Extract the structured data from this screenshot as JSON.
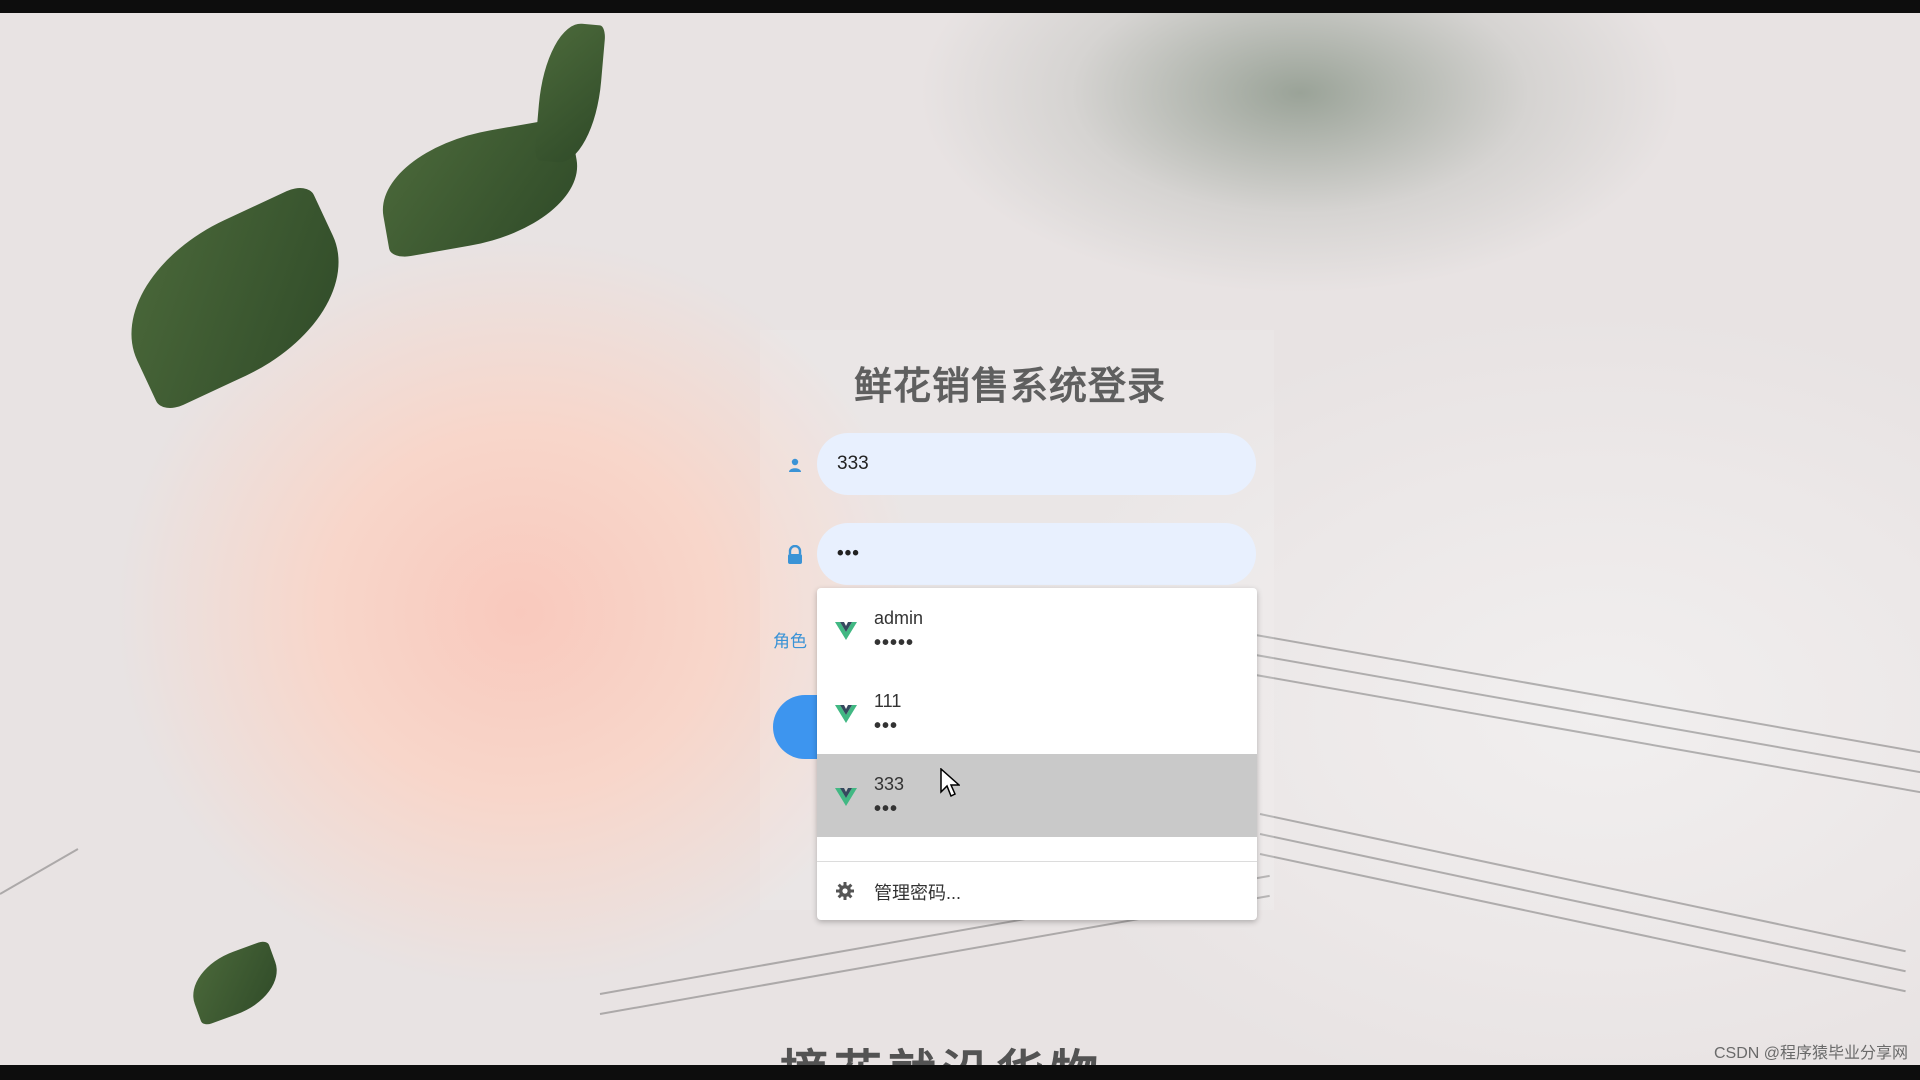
{
  "page": {
    "title": "鲜花销售系统登录",
    "watermark": "CSDN @程序猿毕业分享网",
    "background_caption": "摘花就沿华物"
  },
  "form": {
    "username_value": "333",
    "password_value": "•••",
    "role_label": "角色",
    "username_icon": "user-icon",
    "password_icon": "lock-icon"
  },
  "autofill": {
    "items": [
      {
        "username": "admin",
        "password": "•••••",
        "icon": "vue-logo-icon"
      },
      {
        "username": "111",
        "password": "•••",
        "icon": "vue-logo-icon"
      },
      {
        "username": "333",
        "password": "•••",
        "icon": "vue-logo-icon",
        "highlighted": true
      }
    ],
    "manage_label": "管理密码...",
    "manage_icon": "gear-icon"
  },
  "colors": {
    "input_bg": "#e8f0fe",
    "accent_blue": "#3d95ef",
    "role_label": "#3a93d6",
    "title": "#5f5f5f",
    "hover_row": "#c9c9c9"
  }
}
